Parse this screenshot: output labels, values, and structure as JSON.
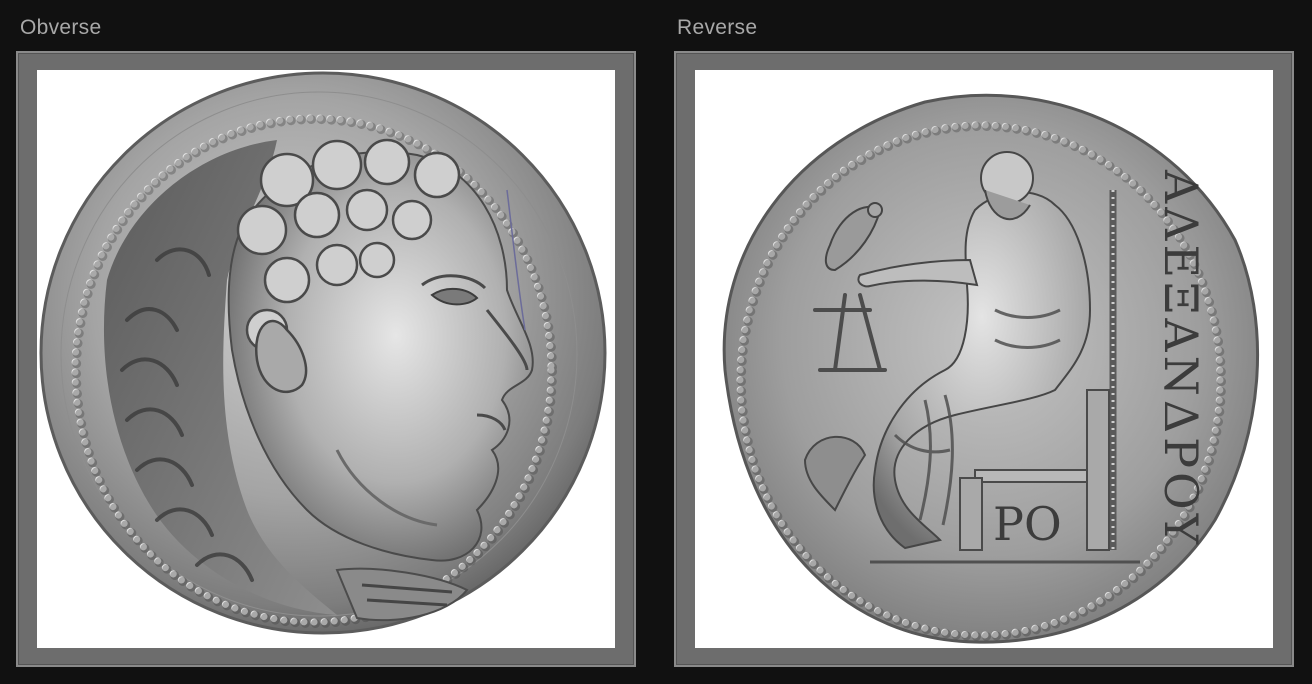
{
  "panels": [
    {
      "label": "Obverse",
      "image_name": "coin-obverse-image",
      "depicts": "portrait-head-with-lion-skin"
    },
    {
      "label": "Reverse",
      "image_name": "coin-reverse-image",
      "depicts": "seated-zeus-with-eagle-and-scepter"
    }
  ],
  "reverse_legend": "ΑΛΕΞΑΝΔΡΟΥ",
  "reverse_monogram": "ΡΟ",
  "colors": {
    "background": "#111111",
    "frame": "#6d6d6d",
    "label": "#a8a8a8",
    "silver_light": "#d6d6d6",
    "silver_mid": "#9a9a9a",
    "silver_dark": "#4a4a4a"
  }
}
